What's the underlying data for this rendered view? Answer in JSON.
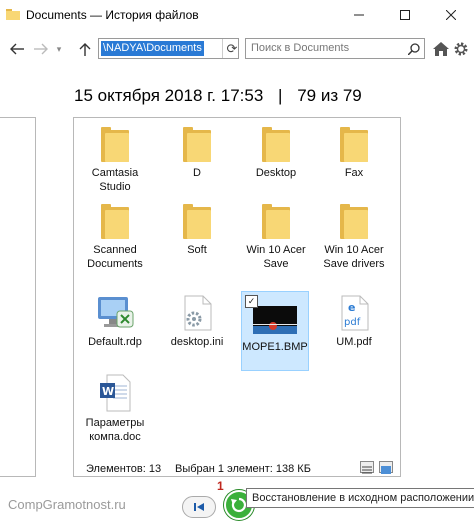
{
  "window": {
    "title": "Documents — История файлов",
    "controls": [
      "minimize-icon",
      "maximize-icon",
      "close-icon"
    ]
  },
  "nav": {
    "address": "\\NADYA\\Documents",
    "search_placeholder": "Поиск в Documents"
  },
  "header": {
    "date": "15 октября 2018 г. 17:53",
    "separator": "|",
    "position": "79 из 79"
  },
  "files": [
    {
      "label": "Camtasia Studio",
      "kind": "folder"
    },
    {
      "label": "D",
      "kind": "folder"
    },
    {
      "label": "Desktop",
      "kind": "folder"
    },
    {
      "label": "Fax",
      "kind": "folder"
    },
    {
      "label": "Scanned Documents",
      "kind": "folder"
    },
    {
      "label": "Soft",
      "kind": "folder"
    },
    {
      "label": "Win 10 Acer Save",
      "kind": "folder"
    },
    {
      "label": "Win 10 Acer Save drivers",
      "kind": "folder"
    },
    {
      "label": "Default.rdp",
      "kind": "rdp"
    },
    {
      "label": "desktop.ini",
      "kind": "ini"
    },
    {
      "label": "MOPE1.BMP",
      "kind": "bmp",
      "selected": true
    },
    {
      "label": "UM.pdf",
      "kind": "pdf"
    },
    {
      "label": "Параметры компа.doc",
      "kind": "doc"
    }
  ],
  "status": {
    "items_count": "Элементов: 13",
    "selection": "Выбран 1 элемент: 138 КБ"
  },
  "footer": {
    "watermark": "CompGramotnost.ru",
    "badge": "1",
    "tooltip": "Восстановление в исходном расположении."
  }
}
